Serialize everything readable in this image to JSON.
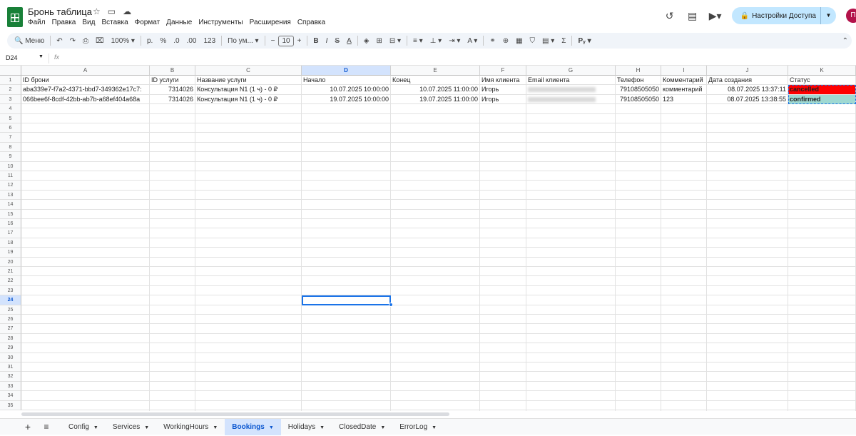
{
  "doc": {
    "title": "Бронь таблица"
  },
  "menu": [
    "Файл",
    "Правка",
    "Вид",
    "Вставка",
    "Формат",
    "Данные",
    "Инструменты",
    "Расширения",
    "Справка"
  ],
  "share": {
    "label": "Настройки Доступа"
  },
  "avatar": "П",
  "toolbar": {
    "search": "Меню",
    "zoom": "100%",
    "currency": "р.",
    "percent": "%",
    "dec_minus": ".0",
    "dec_plus": ".00",
    "number": "123",
    "font": "По ум...",
    "font_size": "10"
  },
  "formula_bar": {
    "cell_ref": "D24",
    "fx": "fx"
  },
  "columns": [
    "A",
    "B",
    "C",
    "D",
    "E",
    "F",
    "G",
    "H",
    "I",
    "J",
    "K"
  ],
  "selected_column": "D",
  "header_row": [
    "ID брони",
    "ID услуги",
    "Название услуги",
    "Начало",
    "Конец",
    "Имя клиента",
    "Email клиента",
    "Телефон",
    "Комментарий",
    "Дата создания",
    "Статус"
  ],
  "rows": [
    [
      "aba339e7-f7a2-4371-bbd7-349362e17c7:",
      "7314026",
      "Консультация N1 (1 ч) - 0 ₽",
      "10.07.2025 10:00:00",
      "10.07.2025 11:00:00",
      "Игорь",
      "",
      "79108505050",
      "комментарий",
      "08.07.2025 13:37:11",
      "cancelled"
    ],
    [
      "066bee6f-8cdf-42bb-ab7b-a68ef404a68a",
      "7314026",
      "Консультация N1 (1 ч) - 0 ₽",
      "19.07.2025 10:00:00",
      "19.07.2025 11:00:00",
      "Игорь",
      "",
      "79108505050",
      "123",
      "08.07.2025 13:38:55",
      "confirmed"
    ]
  ],
  "row_numbers": [
    "1",
    "2",
    "3",
    "4",
    "5",
    "6",
    "7",
    "8",
    "9",
    "10",
    "11",
    "12",
    "13",
    "14",
    "15",
    "16",
    "17",
    "18",
    "19",
    "20",
    "21",
    "22",
    "23",
    "24",
    "25",
    "26",
    "27",
    "28",
    "29",
    "30",
    "31",
    "32",
    "33",
    "34",
    "35"
  ],
  "selected_row": "24",
  "status_colors": {
    "cancelled": "#ff0000",
    "confirmed": "#9fd9d2"
  },
  "sheets": [
    "Config",
    "Services",
    "WorkingHours",
    "Bookings",
    "Holidays",
    "ClosedDate",
    "ErrorLog"
  ],
  "active_sheet": "Bookings"
}
